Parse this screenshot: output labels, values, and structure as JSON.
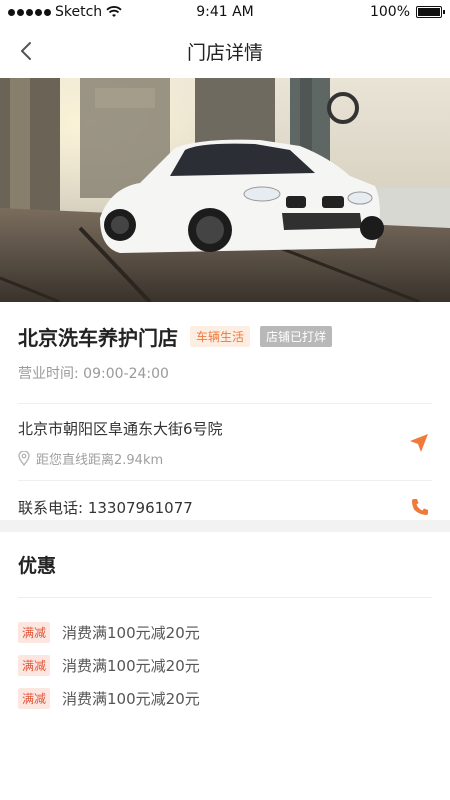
{
  "status_bar": {
    "carrier": "Sketch",
    "time": "9:41 AM",
    "battery": "100%"
  },
  "nav": {
    "title": "门店详情"
  },
  "store": {
    "name": "北京洗车养护门店",
    "tag_category": "车辆生活",
    "tag_status": "店铺已打烊",
    "hours": "营业时间: 09:00-24:00",
    "address": "北京市朝阳区阜通东大街6号院",
    "distance": "距您直线距离2.94km",
    "phone": "联系电话: 13307961077"
  },
  "promotions": {
    "title": "优惠",
    "items": [
      {
        "tag": "满减",
        "text": "消费满100元减20元"
      },
      {
        "tag": "满减",
        "text": "消费满100元减20元"
      },
      {
        "tag": "满减",
        "text": "消费满100元减20元"
      }
    ]
  },
  "colors": {
    "accent": "#f07a3a",
    "promo_tag": "#e0553a",
    "section_gap": "#f2f2f2"
  }
}
